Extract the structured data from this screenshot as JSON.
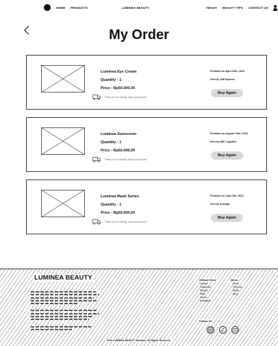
{
  "nav": {
    "home": "HOME",
    "products": "PRODUCTS",
    "brand": "LUMINEA BEAUTY",
    "about": "ABOUT",
    "beauty_tips": "BEAUTY TIPS",
    "contact": "CONTACT US"
  },
  "page": {
    "title": "My Order"
  },
  "orders": [
    {
      "name": "Luminea Eye Cream",
      "quantity": "Quantity : 1",
      "price": "Price : Rp50.000,00",
      "note": "\"Thank you for ordering, enjoy your product!\"",
      "finished": "Finished on April 15th, 2024",
      "sent_by": "Sent by JNE Express",
      "button": "Buy Again"
    },
    {
      "name": "Luminea Sunscreen",
      "quantity": "Quantity : 1",
      "price": "Price : Rp50.000,00",
      "note": "\"Thank you for ordering, enjoy your product!\"",
      "finished": "Finished on August 10th, 2024",
      "sent_by": "Sent by ABC Logistics",
      "button": "Buy Again"
    },
    {
      "name": "Luminea Mask Series",
      "quantity": "Quantity : 1",
      "price": "Price : Rp50.000,00",
      "note": "\"Thank you for ordering, enjoy your product!\"",
      "finished": "Finished on June 9th, 2024",
      "sent_by": "Sent by Anteraja",
      "button": "Buy Again"
    }
  ],
  "footer": {
    "brand": "LUMINEA BEAUTY",
    "official_store_heading": "Official Store",
    "official_store": [
      "Lazada",
      "Tokopedia",
      "Shopee",
      "Blibli",
      "Zalora",
      "Bukalapak"
    ],
    "menu_heading": "Menu",
    "menu": [
      "Home",
      "Products",
      "About",
      "Blog"
    ],
    "follow_heading": "Follow Us",
    "copyright": "2024 LUMINEA BEAUTY Skincare. All Rights Reserved."
  }
}
